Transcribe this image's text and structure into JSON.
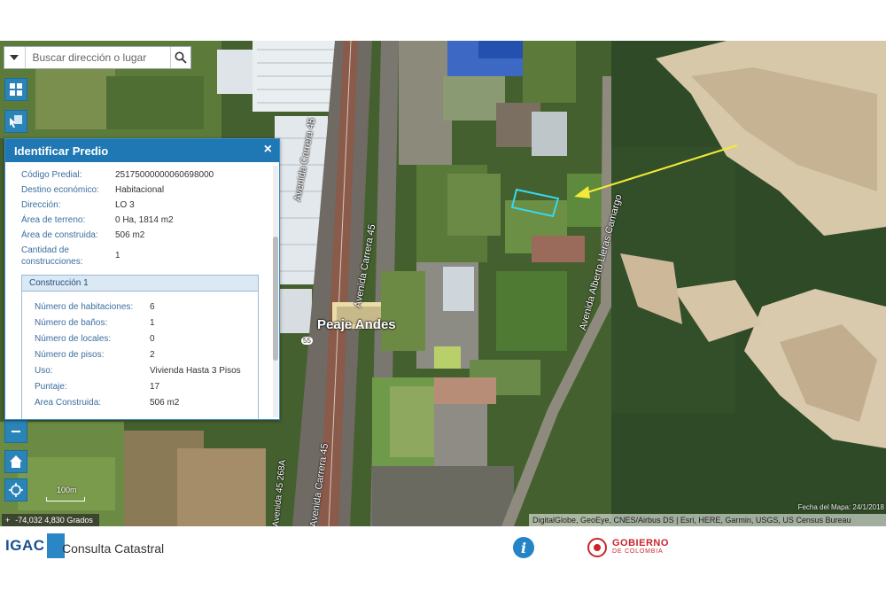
{
  "search": {
    "placeholder": "Buscar dirección o lugar"
  },
  "panel": {
    "title": "Identificar Predio",
    "close": "×",
    "fields": [
      {
        "label": "Código Predial:",
        "value": "25175000000060698000"
      },
      {
        "label": "Destino económico:",
        "value": "Habitacional"
      },
      {
        "label": "Dirección:",
        "value": "LO 3"
      },
      {
        "label": "Área de terreno:",
        "value": "0 Ha, 1814 m2"
      },
      {
        "label": "Área de construida:",
        "value": "506 m2"
      },
      {
        "label": "Cantidad de construcciones:",
        "value": "1"
      }
    ],
    "construction": {
      "title": "Construcción 1",
      "fields": [
        {
          "label": "Número de habitaciones:",
          "value": "6"
        },
        {
          "label": "Número de baños:",
          "value": "1"
        },
        {
          "label": "Número de locales:",
          "value": "0"
        },
        {
          "label": "Número de pisos:",
          "value": "2"
        },
        {
          "label": "Uso:",
          "value": "Vivienda Hasta 3 Pisos"
        },
        {
          "label": "Puntaje:",
          "value": "17"
        },
        {
          "label": "Area Construida:",
          "value": "506 m2"
        }
      ]
    }
  },
  "map": {
    "labels": {
      "peaje": "Peaje Andes",
      "avenida_carrera_1": "Avenida Carrera 45",
      "avenida_carrera_2": "Avenida Carrera 45",
      "avenida_carrera_3": "Avenida Carrera 45",
      "avenida_carrera_4": "Avenida 45 268A",
      "avenida_alberto": "Avenida Alberto Lleras Camargo",
      "route": "55"
    },
    "scale": "100m",
    "coordinates": "-74,032 4,830 Grados",
    "date": "Fecha del Mapa: 24/1/2018",
    "attribution": "DigitalGlobe, GeoEye, CNES/Airbus DS | Esri, HERE, Garmin, USGS, US Census Bureau",
    "arrow_color": "#f3e93a",
    "highlight_color": "#38d8f0"
  },
  "footer": {
    "igac": "IGAC",
    "app_name": "Consulta Catastral",
    "info": "i",
    "gov_line1": "GOBIERNO",
    "gov_line2": "DE COLOMBIA"
  }
}
